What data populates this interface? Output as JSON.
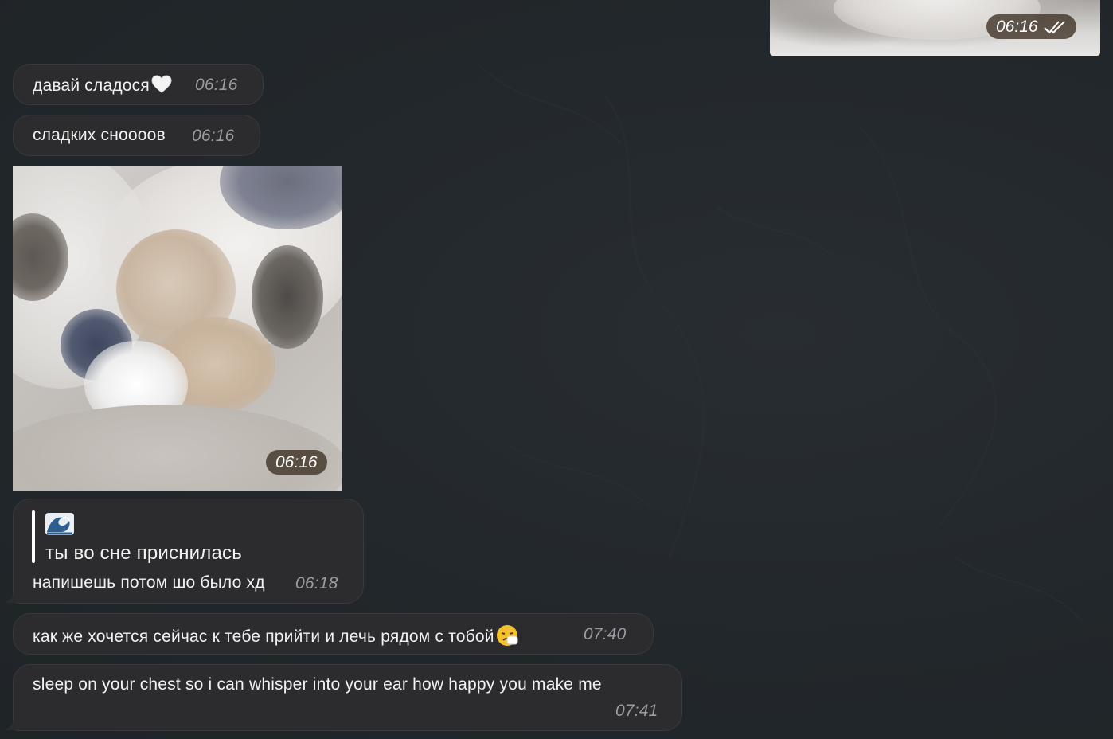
{
  "chat": {
    "outgoing_photo": {
      "time": "06:16",
      "status_icon": "double-check-icon"
    },
    "messages": [
      {
        "text": "давай сладося",
        "emoji_icon": "white-heart-icon",
        "time": "06:16"
      },
      {
        "text": "сладких снoooов",
        "time": "06:16"
      },
      {
        "photo": "kissing-kittens-photo",
        "time": "06:16"
      },
      {
        "reply": {
          "emoji_icon": "water-wave-icon",
          "quoted_text": "ты во сне приснилась"
        },
        "text": "напишешь потом шо было хд",
        "time": "06:18"
      },
      {
        "text": "как же хочется сейчас к тебе прийти и лечь рядом с тобой",
        "emoji_icon": "sneezing-face-icon",
        "time": "07:40"
      },
      {
        "text": "sleep on your chest so i can whisper into your ear how happy you make me",
        "time": "07:41"
      }
    ]
  },
  "colors": {
    "background": "#22272b",
    "bubble": "#2c2c2e",
    "timestamp": "#9a9ca3",
    "timestamp_pill": "#3c3022"
  }
}
